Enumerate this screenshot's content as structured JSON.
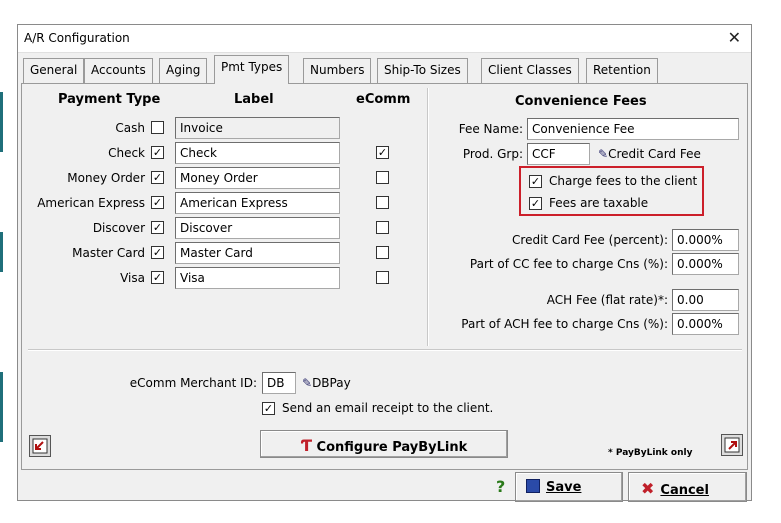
{
  "window": {
    "title": "A/R Configuration",
    "close_glyph": "✕"
  },
  "tabs": [
    {
      "label": "General"
    },
    {
      "label": "Accounts"
    },
    {
      "label": "Aging"
    },
    {
      "label": "Pmt Types",
      "active": true
    },
    {
      "label": "Numbers"
    },
    {
      "label": "Ship-To Sizes"
    },
    {
      "label": "Client Classes"
    },
    {
      "label": "Retention"
    }
  ],
  "payment_types": {
    "headers": {
      "type": "Payment Type",
      "label": "Label",
      "ecomm": "eComm"
    },
    "rows": [
      {
        "type": "Cash",
        "enabled": false,
        "label": "Invoice",
        "label_readonly": true,
        "ecomm": null
      },
      {
        "type": "Check",
        "enabled": true,
        "label": "Check",
        "ecomm": true
      },
      {
        "type": "Money Order",
        "enabled": true,
        "label": "Money Order",
        "ecomm": false
      },
      {
        "type": "American Express",
        "enabled": true,
        "label": "American Express",
        "ecomm": false
      },
      {
        "type": "Discover",
        "enabled": true,
        "label": "Discover",
        "ecomm": false
      },
      {
        "type": "Master Card",
        "enabled": true,
        "label": "Master Card",
        "ecomm": false
      },
      {
        "type": "Visa",
        "enabled": true,
        "label": "Visa",
        "ecomm": false
      }
    ]
  },
  "convenience_fees": {
    "header": "Convenience Fees",
    "fee_name_label": "Fee Name:",
    "fee_name_value": "Convenience Fee",
    "prod_grp_label": "Prod. Grp:",
    "prod_grp_value": "CCF",
    "prod_grp_link": "Credit Card Fee",
    "charge_to_client_label": "Charge fees to the client",
    "charge_to_client_checked": true,
    "taxable_label": "Fees are taxable",
    "taxable_checked": true,
    "cc_fee_label": "Credit Card Fee (percent):",
    "cc_fee_value": "0.000%",
    "cc_part_label": "Part of CC fee to charge Cns (%):",
    "cc_part_value": "0.000%",
    "ach_fee_label": "ACH Fee (flat rate)*:",
    "ach_fee_value": "0.00",
    "ach_part_label": "Part of ACH fee to charge Cns (%):",
    "ach_part_value": "0.000%"
  },
  "ecomm": {
    "merchant_id_label": "eComm Merchant ID:",
    "merchant_id_value": "DB",
    "merchant_link": "DBPay",
    "email_receipt_label": "Send an email receipt to the client.",
    "email_receipt_checked": true,
    "configure_label": "Configure PayByLink",
    "paybylink_note": "* PayByLink only"
  },
  "footer": {
    "help_glyph": "?",
    "save_label": "Save",
    "cancel_label": "Cancel"
  },
  "colors": {
    "highlight": "#cc1f2a",
    "cancel_x": "#c0202a",
    "configure_icon": "#c0202a"
  }
}
